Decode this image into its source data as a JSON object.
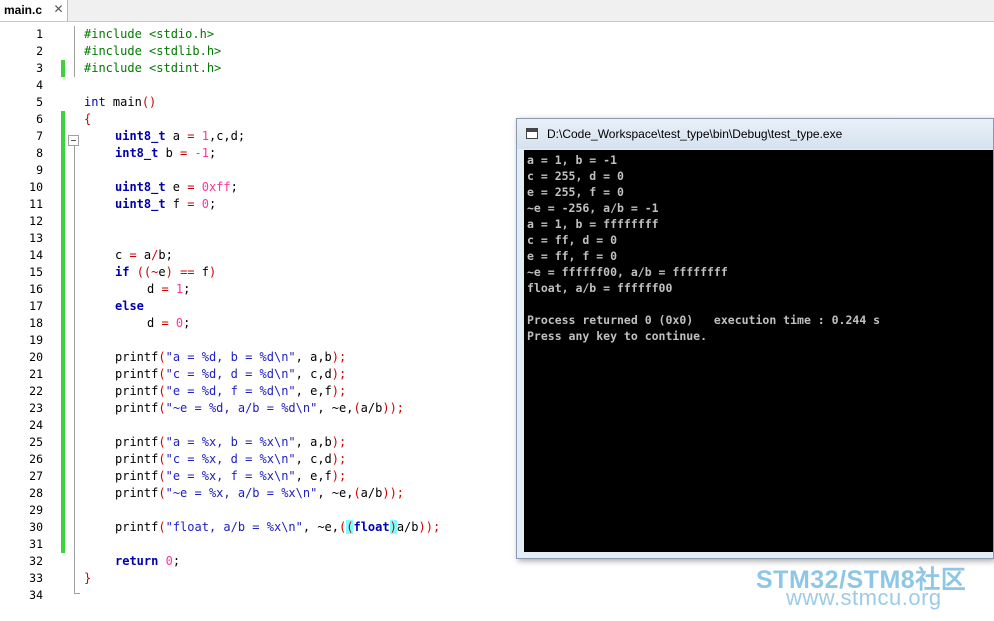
{
  "tab": {
    "label": "main.c",
    "close": "✕"
  },
  "editor": {
    "line_numbers": [
      "1",
      "2",
      "3",
      "4",
      "5",
      "6",
      "7",
      "8",
      "9",
      "10",
      "11",
      "12",
      "13",
      "14",
      "15",
      "16",
      "17",
      "18",
      "19",
      "20",
      "21",
      "22",
      "23",
      "24",
      "25",
      "26",
      "27",
      "28",
      "29",
      "30",
      "31",
      "32",
      "33",
      "34"
    ],
    "lines": {
      "l1": "#include <stdio.h>",
      "l2": "#include <stdlib.h>",
      "l3": "#include <stdint.h>",
      "l5a": "int",
      "l5b": " main",
      "l5c": "()",
      "l6": "{",
      "l7a": "uint8_t",
      "l7b": " a ",
      "l7c": "=",
      "l7d": " ",
      "l7e": "1",
      "l7f": ",c,d;",
      "l8a": "int8_t",
      "l8b": " b ",
      "l8c": "=",
      "l8d": " ",
      "l8e": "-1",
      "l8f": ";",
      "l10a": "uint8_t",
      "l10b": " e ",
      "l10c": "=",
      "l10d": " ",
      "l10e": "0xff",
      "l10f": ";",
      "l11a": "uint8_t",
      "l11b": " f ",
      "l11c": "=",
      "l11d": " ",
      "l11e": "0",
      "l11f": ";",
      "l14a": "c ",
      "l14b": "=",
      "l14c": " a",
      "l14d": "/",
      "l14e": "b;",
      "l15a": "if",
      "l15b": " ",
      "l15c": "((~",
      "l15d": "e",
      "l15e": ")",
      "l15f": " == ",
      "l15g": "f",
      "l15h": ")",
      "l16a": "d ",
      "l16b": "=",
      "l16c": " ",
      "l16d": "1",
      "l16e": ";",
      "l17": "else",
      "l18a": "d ",
      "l18b": "=",
      "l18c": " ",
      "l18d": "0",
      "l18e": ";",
      "l20a": "printf",
      "l20b": "(",
      "l20c": "\"a = %d, b = %d\\n\"",
      "l20d": ", a,b",
      "l20e": ");",
      "l21a": "printf",
      "l21b": "(",
      "l21c": "\"c = %d, d = %d\\n\"",
      "l21d": ", c,d",
      "l21e": ");",
      "l22a": "printf",
      "l22b": "(",
      "l22c": "\"e = %d, f = %d\\n\"",
      "l22d": ", e,f",
      "l22e": ");",
      "l23a": "printf",
      "l23b": "(",
      "l23c": "\"~e = %d, a/b = %d\\n\"",
      "l23d": ", ~e,",
      "l23e": "(",
      "l23f": "a/b",
      "l23g": "));",
      "l25a": "printf",
      "l25b": "(",
      "l25c": "\"a = %x, b = %x\\n\"",
      "l25d": ", a,b",
      "l25e": ");",
      "l26a": "printf",
      "l26b": "(",
      "l26c": "\"c = %x, d = %x\\n\"",
      "l26d": ", c,d",
      "l26e": ");",
      "l27a": "printf",
      "l27b": "(",
      "l27c": "\"e = %x, f = %x\\n\"",
      "l27d": ", e,f",
      "l27e": ");",
      "l28a": "printf",
      "l28b": "(",
      "l28c": "\"~e = %x, a/b = %x\\n\"",
      "l28d": ", ~e,",
      "l28e": "(",
      "l28f": "a/b",
      "l28g": "));",
      "l30a": "printf",
      "l30b": "(",
      "l30c": "\"float, a/b = %x\\n\"",
      "l30d": ", ~e,",
      "l30e": "(",
      "l30f": "(",
      "l30g": "float",
      "l30h": ")",
      "l30i": "a/b",
      "l30j": "));",
      "l32a": "return",
      "l32b": " ",
      "l32c": "0",
      "l32d": ";",
      "l33": "}"
    }
  },
  "console": {
    "title": "D:\\Code_Workspace\\test_type\\bin\\Debug\\test_type.exe",
    "output": [
      "a = 1, b = -1",
      "c = 255, d = 0",
      "e = 255, f = 0",
      "~e = -256, a/b = -1",
      "a = 1, b = ffffffff",
      "c = ff, d = 0",
      "e = ff, f = 0",
      "~e = ffffff00, a/b = ffffffff",
      "float, a/b = ffffff00",
      "",
      "Process returned 0 (0x0)   execution time : 0.244 s",
      "Press any key to continue."
    ]
  },
  "watermark": {
    "line1": "STM32/STM8社区",
    "line2": "www.stmcu.org"
  },
  "colors": {
    "preprocessor": "#007a00",
    "keyword": "#0000b0",
    "number": "#ff3399",
    "string": "#2020c0",
    "operator": "#cc0000",
    "change_marker": "#3fd23f",
    "brace_highlight": "#80ffff"
  }
}
